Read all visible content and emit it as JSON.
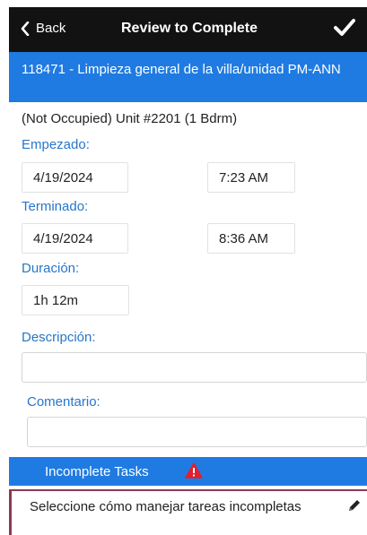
{
  "header": {
    "back_label": "Back",
    "title": "Review to Complete"
  },
  "banner": {
    "text": "118471 - Limpieza general de la villa/unidad PM-ANN"
  },
  "unit_info": "(Not Occupied) Unit #2201 (1 Bdrm)",
  "started": {
    "label": "Empezado:",
    "date": "4/19/2024",
    "time": "7:23 AM"
  },
  "finished": {
    "label": "Terminado:",
    "date": "4/19/2024",
    "time": "8:36 AM"
  },
  "duration": {
    "label": "Duración:",
    "value": "1h 12m"
  },
  "description": {
    "label": "Descripción:",
    "value": ""
  },
  "comment": {
    "label": "Comentario:",
    "value": ""
  },
  "incomplete_tasks": {
    "label": "Incomplete Tasks"
  },
  "manage_tasks": {
    "text": "Seleccione cómo manejar tareas incompletas"
  },
  "colors": {
    "header_bg": "#121212",
    "accent_blue": "#1f7be1",
    "label_blue": "#2776c9",
    "warning_red": "#e0202f",
    "selected_border": "#8a3a56"
  }
}
